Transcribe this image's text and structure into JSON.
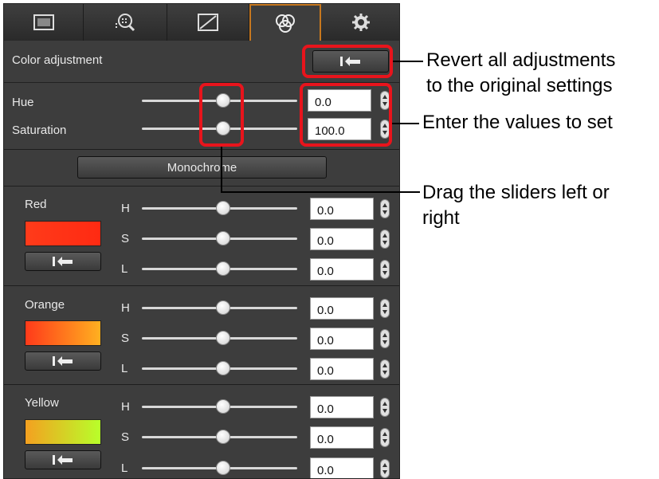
{
  "tabs": [
    {
      "icon": "image-frame-icon"
    },
    {
      "icon": "zoom-grid-icon"
    },
    {
      "icon": "tone-curve-icon"
    },
    {
      "icon": "color-circles-icon",
      "active": true
    },
    {
      "icon": "gear-icon"
    }
  ],
  "section": {
    "title": "Color adjustment",
    "revert_icon": "revert-arrow-icon"
  },
  "hue": {
    "label": "Hue",
    "value": "0.0"
  },
  "saturation": {
    "label": "Saturation",
    "value": "100.0"
  },
  "monochrome_label": "Monochrome",
  "channels": [
    {
      "name": "Red",
      "h": "0.0",
      "s": "0.0",
      "l": "0.0",
      "color_left": "#ff3b1a",
      "color_right": "#ff2a12"
    },
    {
      "name": "Orange",
      "h": "0.0",
      "s": "0.0",
      "l": "0.0",
      "color_left": "#ff3a1a",
      "color_right": "#ffb020"
    },
    {
      "name": "Yellow",
      "h": "0.0",
      "s": "0.0",
      "l": "0.0",
      "color_left": "#f4a020",
      "color_right": "#b8ff2a"
    }
  ],
  "hsl_letters": {
    "h": "H",
    "s": "S",
    "l": "L"
  },
  "annotations": {
    "revert_line1": "Revert all adjustments",
    "revert_line2": "to the original settings",
    "enter": "Enter the values to set",
    "drag_line1": "Drag the sliders left or",
    "drag_line2": "right"
  },
  "accent_color": "#c8781e",
  "callout_color": "#e8141c"
}
